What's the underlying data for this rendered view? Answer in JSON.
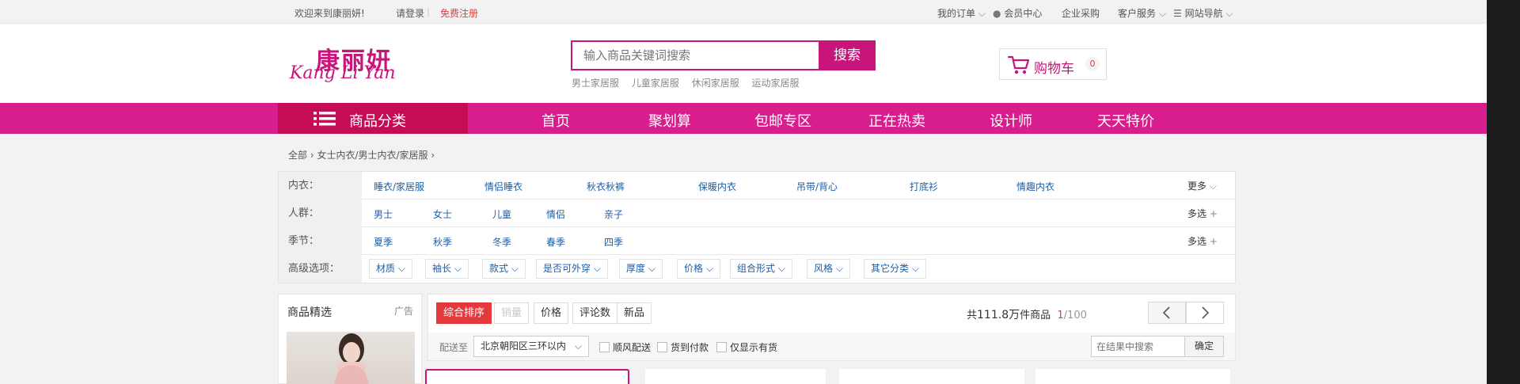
{
  "topbar": {
    "welcome": "欢迎来到康丽妍!",
    "login": "请登录",
    "register": "免费注册",
    "my_orders": "我的订单",
    "member": "会员中心",
    "enterprise": "企业采购",
    "service": "客户服务",
    "sitemap": "网站导航"
  },
  "header": {
    "logo_cn": "康丽妍",
    "logo_en": "Kang Li Yan",
    "search_placeholder": "输入商品关键词搜索",
    "search_button": "搜索",
    "hotwords": [
      "男士家居服",
      "儿童家居服",
      "休闲家居服",
      "运动家居服"
    ],
    "cart_label": "购物车",
    "cart_count": "0"
  },
  "nav": {
    "category": "商品分类",
    "items": [
      "首页",
      "聚划算",
      "包邮专区",
      "正在热卖",
      "设计师",
      "天天特价"
    ]
  },
  "breadcrumb": {
    "all": "全部",
    "path": "女士内衣/男士内衣/家居服"
  },
  "filters": {
    "underwear": {
      "label": "内衣：",
      "values": [
        "睡衣/家居服",
        "情侣睡衣",
        "秋衣秋裤",
        "保暖内衣",
        "吊带/背心",
        "打底衫",
        "情趣内衣"
      ],
      "more": "更多"
    },
    "crowd": {
      "label": "人群：",
      "values": [
        "男士",
        "女士",
        "儿童",
        "情侣",
        "亲子"
      ],
      "multi": "多选"
    },
    "season": {
      "label": "季节：",
      "values": [
        "夏季",
        "秋季",
        "冬季",
        "春季",
        "四季"
      ],
      "multi": "多选"
    },
    "advanced": {
      "label": "高级选项：",
      "options": [
        "材质",
        "袖长",
        "款式",
        "是否可外穿",
        "厚度",
        "价格",
        "组合形式",
        "风格",
        "其它分类"
      ]
    }
  },
  "sidebar": {
    "title": "商品精选",
    "ad": "广告"
  },
  "sort": {
    "buttons": [
      "综合排序",
      "销量",
      "价格",
      "评论数",
      "新品"
    ],
    "total_prefix": "共",
    "total_value": "111.8万",
    "total_suffix": "件商品",
    "page_current": "1",
    "page_total": "/100"
  },
  "delivery": {
    "label": "配送至",
    "area": "北京朝阳区三环以内",
    "checks": [
      "顺风配送",
      "货到付款",
      "仅显示有货"
    ],
    "within_placeholder": "在结果中搜索",
    "confirm": "确定"
  },
  "colors": {
    "brand": "#c8157a",
    "nav": "#d81e8c",
    "category": "#c40d55",
    "accent": "#e4393c",
    "link": "#1c5ea8"
  }
}
